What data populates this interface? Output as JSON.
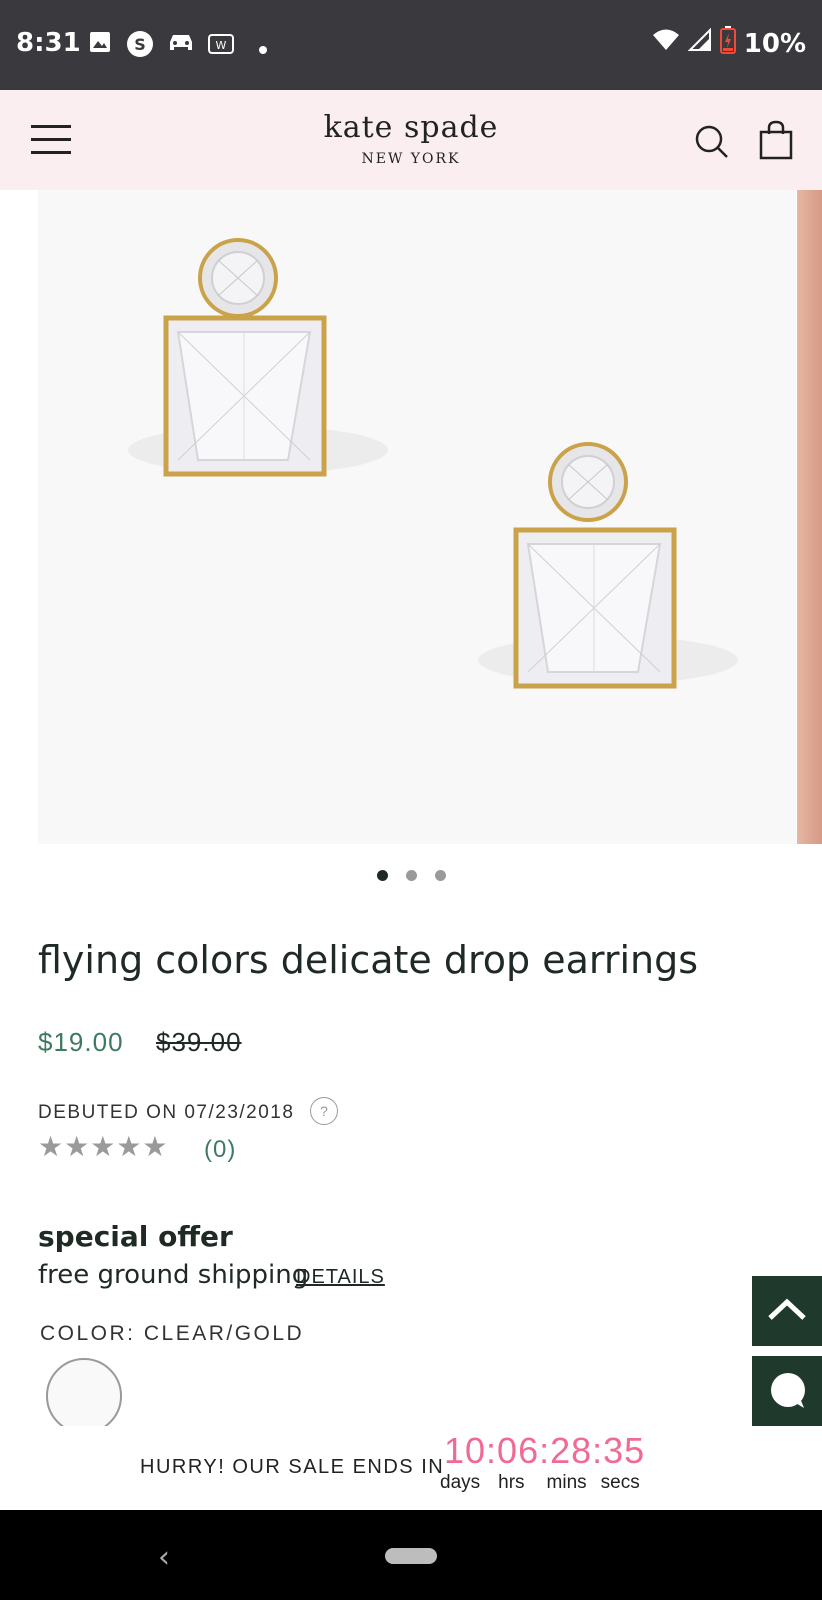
{
  "status_bar": {
    "time": "8:31",
    "battery": "10%",
    "notification_icons": [
      "image-icon",
      "s-icon",
      "car-icon",
      "w-icon",
      "dot-icon"
    ],
    "system_icons": [
      "wifi-icon",
      "signal-icon",
      "battery-icon"
    ]
  },
  "header": {
    "brand_name": "kate spade",
    "brand_sub": "NEW YORK",
    "icons": [
      "menu-icon",
      "search-icon",
      "shopping-bag-icon"
    ]
  },
  "gallery": {
    "image": "earrings product photo",
    "active_index": 0,
    "dot_count": 3
  },
  "product": {
    "title": "flying colors delicate drop earrings",
    "sale_price": "$19.00",
    "original_price": "$39.00",
    "debuted": "DEBUTED ON 07/23/2018",
    "help_icon_label": "?",
    "stars_display": "★★★★★",
    "rating": 0,
    "review_count": "(0)"
  },
  "offer": {
    "title": "special offer",
    "text": "free ground shipping",
    "link": "DETAILS"
  },
  "color": {
    "label": "COLOR: CLEAR/GOLD",
    "swatch_color": "#f9f9f9"
  },
  "fabs": {
    "scroll_top_icon": "chevron-up-icon",
    "chat_icon": "chat-bubble-icon",
    "color": "#1f3a2c"
  },
  "sale_banner": {
    "label": "HURRY! OUR SALE ENDS IN",
    "countdown": "10:06:28:35",
    "units": [
      "days",
      "hrs",
      "mins",
      "secs"
    ],
    "countdown_color": "#f06a94"
  },
  "nav_bar": {
    "back_glyph": "‹"
  }
}
